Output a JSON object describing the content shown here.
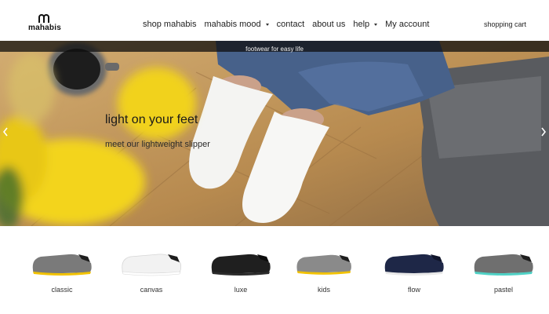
{
  "header": {
    "logo_text": "mahabis",
    "nav": [
      {
        "label": "shop mahabis",
        "dropdown": false
      },
      {
        "label": "mahabis mood",
        "dropdown": true
      },
      {
        "label": "contact",
        "dropdown": false
      },
      {
        "label": "about us",
        "dropdown": false
      },
      {
        "label": "help",
        "dropdown": true
      },
      {
        "label": "My account",
        "dropdown": false
      }
    ],
    "cart_label": "shopping cart"
  },
  "hero": {
    "tagline": "footwear for easy life",
    "title": "light on your feet",
    "subtitle": "meet our lightweight slipper",
    "prev_icon": "chevron-left-icon",
    "next_icon": "chevron-right-icon"
  },
  "products": [
    {
      "label": "classic",
      "upper_color": "#7a7a7a",
      "sole_color": "#f2c200"
    },
    {
      "label": "canvas",
      "upper_color": "#f2f2f2",
      "sole_color": "#ffffff"
    },
    {
      "label": "luxe",
      "upper_color": "#1f1f1f",
      "sole_color": "#2b2b2b"
    },
    {
      "label": "kids",
      "upper_color": "#8a8a8a",
      "sole_color": "#f2c200"
    },
    {
      "label": "flow",
      "upper_color": "#1e2747",
      "sole_color": "#e8e8e8"
    },
    {
      "label": "pastel",
      "upper_color": "#6f6f6f",
      "sole_color": "#4fd1c5"
    }
  ]
}
